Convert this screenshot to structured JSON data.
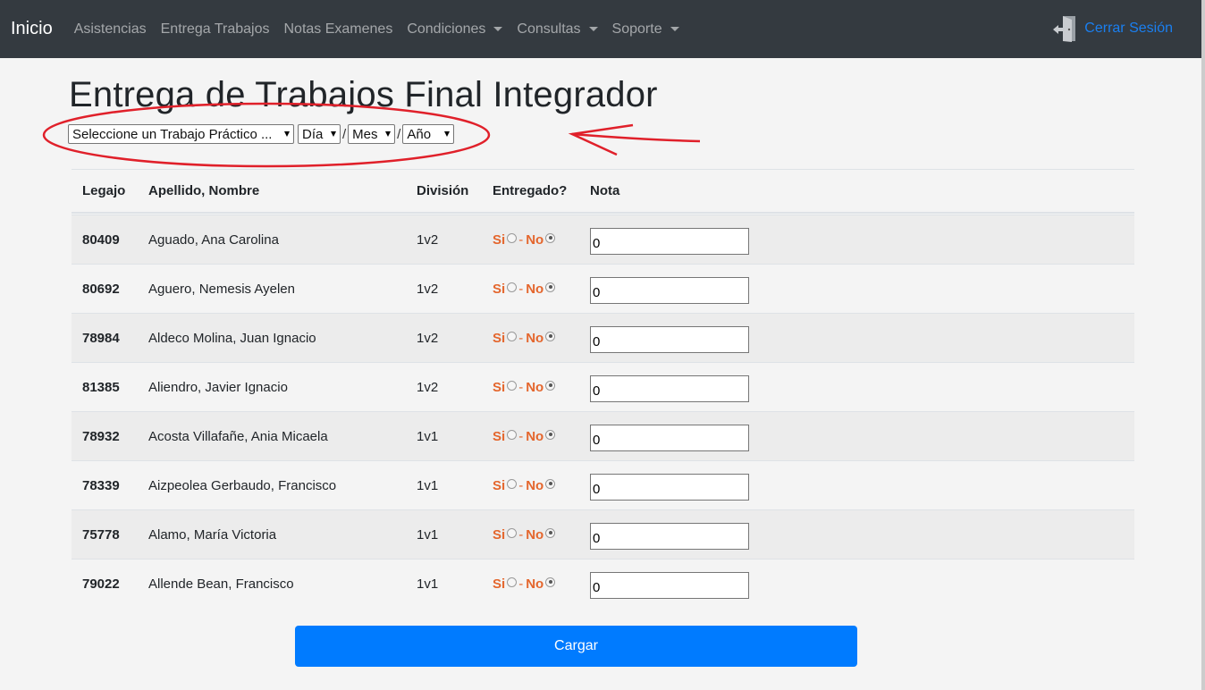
{
  "navbar": {
    "brand": "Inicio",
    "items": [
      {
        "label": "Asistencias",
        "dropdown": false
      },
      {
        "label": "Entrega Trabajos",
        "dropdown": false
      },
      {
        "label": "Notas Examenes",
        "dropdown": false
      },
      {
        "label": "Condiciones",
        "dropdown": true
      },
      {
        "label": "Consultas",
        "dropdown": true
      },
      {
        "label": "Soporte",
        "dropdown": true
      }
    ],
    "logout_label": "Cerrar Sesión",
    "logout_icon": "door-exit-icon"
  },
  "page": {
    "title": "Entrega de Trabajos Final Integrador"
  },
  "filters": {
    "trabajo": "Seleccione un Trabajo Práctico ...",
    "dia": "Día",
    "mes": "Mes",
    "anio": "Año",
    "separator": "/"
  },
  "table": {
    "headers": {
      "legajo": "Legajo",
      "nombre": "Apellido, Nombre",
      "division": "División",
      "entregado": "Entregado?",
      "nota": "Nota"
    },
    "yes_label": "Si",
    "no_label": "No",
    "dash": "-",
    "rows": [
      {
        "legajo": "80409",
        "nombre": "Aguado, Ana Carolina",
        "division": "1v2",
        "entregado": "no",
        "nota": "0"
      },
      {
        "legajo": "80692",
        "nombre": "Aguero, Nemesis Ayelen",
        "division": "1v2",
        "entregado": "no",
        "nota": "0"
      },
      {
        "legajo": "78984",
        "nombre": "Aldeco Molina, Juan Ignacio",
        "division": "1v2",
        "entregado": "no",
        "nota": "0"
      },
      {
        "legajo": "81385",
        "nombre": "Aliendro, Javier Ignacio",
        "division": "1v2",
        "entregado": "no",
        "nota": "0"
      },
      {
        "legajo": "78932",
        "nombre": "Acosta Villafañe, Ania Micaela",
        "division": "1v1",
        "entregado": "no",
        "nota": "0"
      },
      {
        "legajo": "78339",
        "nombre": "Aizpeolea Gerbaudo, Francisco",
        "division": "1v1",
        "entregado": "no",
        "nota": "0"
      },
      {
        "legajo": "75778",
        "nombre": "Alamo, María Victoria",
        "division": "1v1",
        "entregado": "no",
        "nota": "0"
      },
      {
        "legajo": "79022",
        "nombre": "Allende Bean, Francisco",
        "division": "1v1",
        "entregado": "no",
        "nota": "0"
      }
    ]
  },
  "submit_label": "Cargar",
  "colors": {
    "navbar": "#343a40",
    "primary": "#007bff",
    "accent_orange": "#e4662d",
    "annotation_red": "#e0202a"
  }
}
